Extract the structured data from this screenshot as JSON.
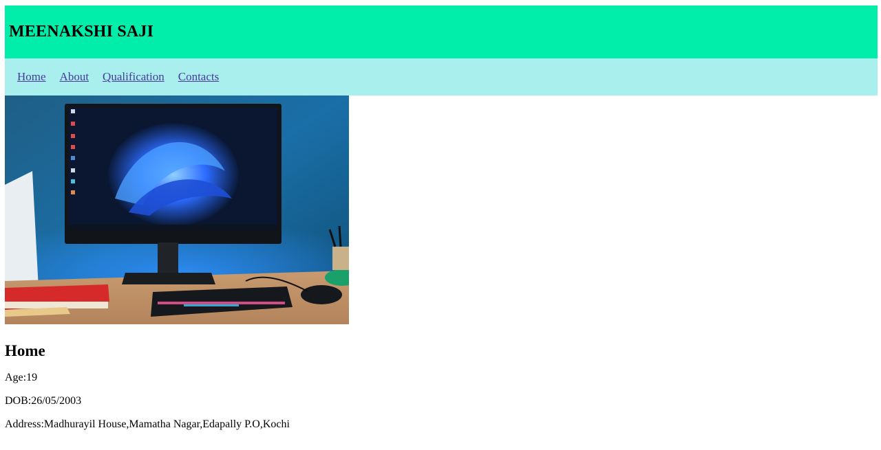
{
  "header": {
    "title": "MEENAKSHI SAJI",
    "bg_color": "#00eeaa"
  },
  "nav": {
    "bg_color": "#a8efee",
    "links": [
      "Home",
      "About",
      "Qualification",
      "Contacts"
    ]
  },
  "hero_image": {
    "icon": "desktop-monitor-photo"
  },
  "main": {
    "heading": "Home",
    "age": "Age:19",
    "dob": "DOB:26/05/2003",
    "address": "Address:Madhurayil House,Mamatha Nagar,Edapally P.O,Kochi"
  }
}
